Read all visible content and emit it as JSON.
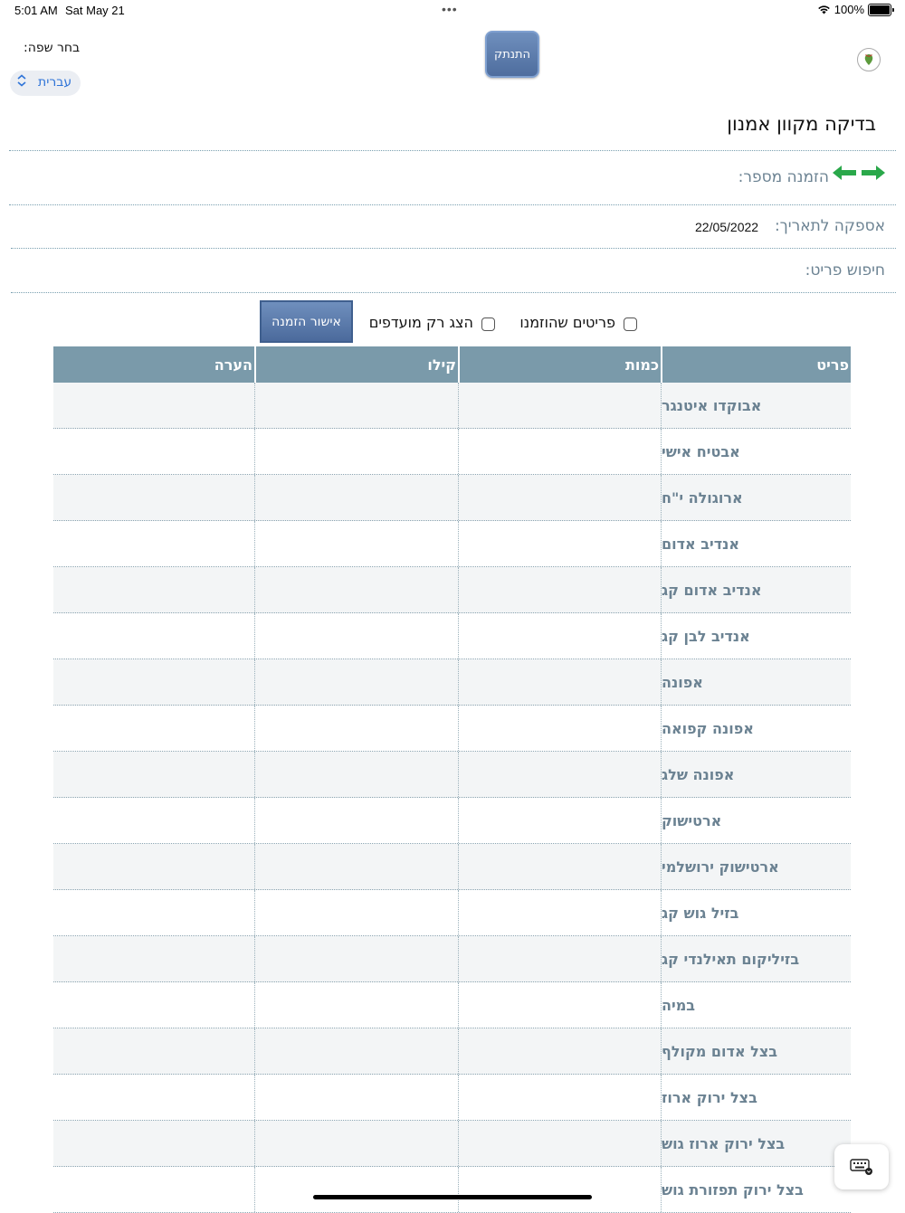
{
  "status_bar": {
    "time": "5:01 AM",
    "date": "Sat May 21",
    "battery": "100%"
  },
  "header": {
    "language_label": "בחר שפה:",
    "language_value": "עברית",
    "disconnect_label": "התנתק"
  },
  "page": {
    "title": "בדיקה מקוון אמנון",
    "order_number_label": "הזמנה מספר:",
    "delivery_date_label": "אספקה לתאריך:",
    "delivery_date": "22/05/2022",
    "search_item_label": "חיפוש פריט:"
  },
  "filters": {
    "ordered_items_label": "פריטים שהוזמנו",
    "favorites_only_label": "הצג רק מועדפים",
    "confirm_order_label": "אישור הזמנה"
  },
  "table": {
    "headers": {
      "item": "פריט",
      "quantity": "כמות",
      "kilo": "קילו",
      "note": "הערה"
    },
    "rows": [
      "אבוקדו איטנגר",
      "אבטיח אישי",
      "ארוגולה י\"ח",
      "אנדיב אדום",
      "אנדיב אדום קג",
      "אנדיב לבן קג",
      "אפונה",
      "אפונה קפואה",
      "אפונה שלג",
      "ארטישוק",
      "ארטישוק ירושלמי",
      "בזיל גוש קג",
      "בזיליקום תאילנדי קג",
      "במיה",
      "בצל אדום מקולף",
      "בצל ירוק ארוז",
      "בצל ירוק ארוז גוש",
      "בצל ירוק תפזורת גוש"
    ]
  },
  "colors": {
    "header_bg": "#7a9aaa",
    "label_text": "#6b8292",
    "button_bg": "#5878a8",
    "link_blue": "#2f74d8",
    "arrow_green": "#2aa84a"
  }
}
